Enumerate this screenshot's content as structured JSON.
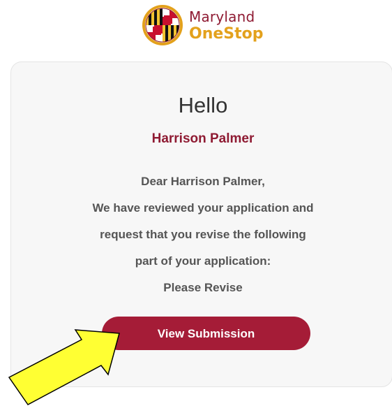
{
  "brand": {
    "line1": "Maryland",
    "line2": "OneStop",
    "logo_icon": "maryland-flag-icon"
  },
  "card": {
    "greeting": "Hello",
    "recipient_name": "Harrison Palmer",
    "message_lines": [
      "Dear Harrison Palmer,",
      "We have reviewed your application and",
      "request that you revise the following",
      "part of your application:",
      "Please Revise"
    ],
    "button_label": "View Submission"
  },
  "annotation": {
    "icon": "pointer-arrow-icon",
    "color": "#ffff33"
  },
  "colors": {
    "brand_maroon": "#8f1b33",
    "brand_gold": "#e3a11c",
    "button_bg": "#a51c37",
    "card_bg": "#f7f7f7"
  }
}
